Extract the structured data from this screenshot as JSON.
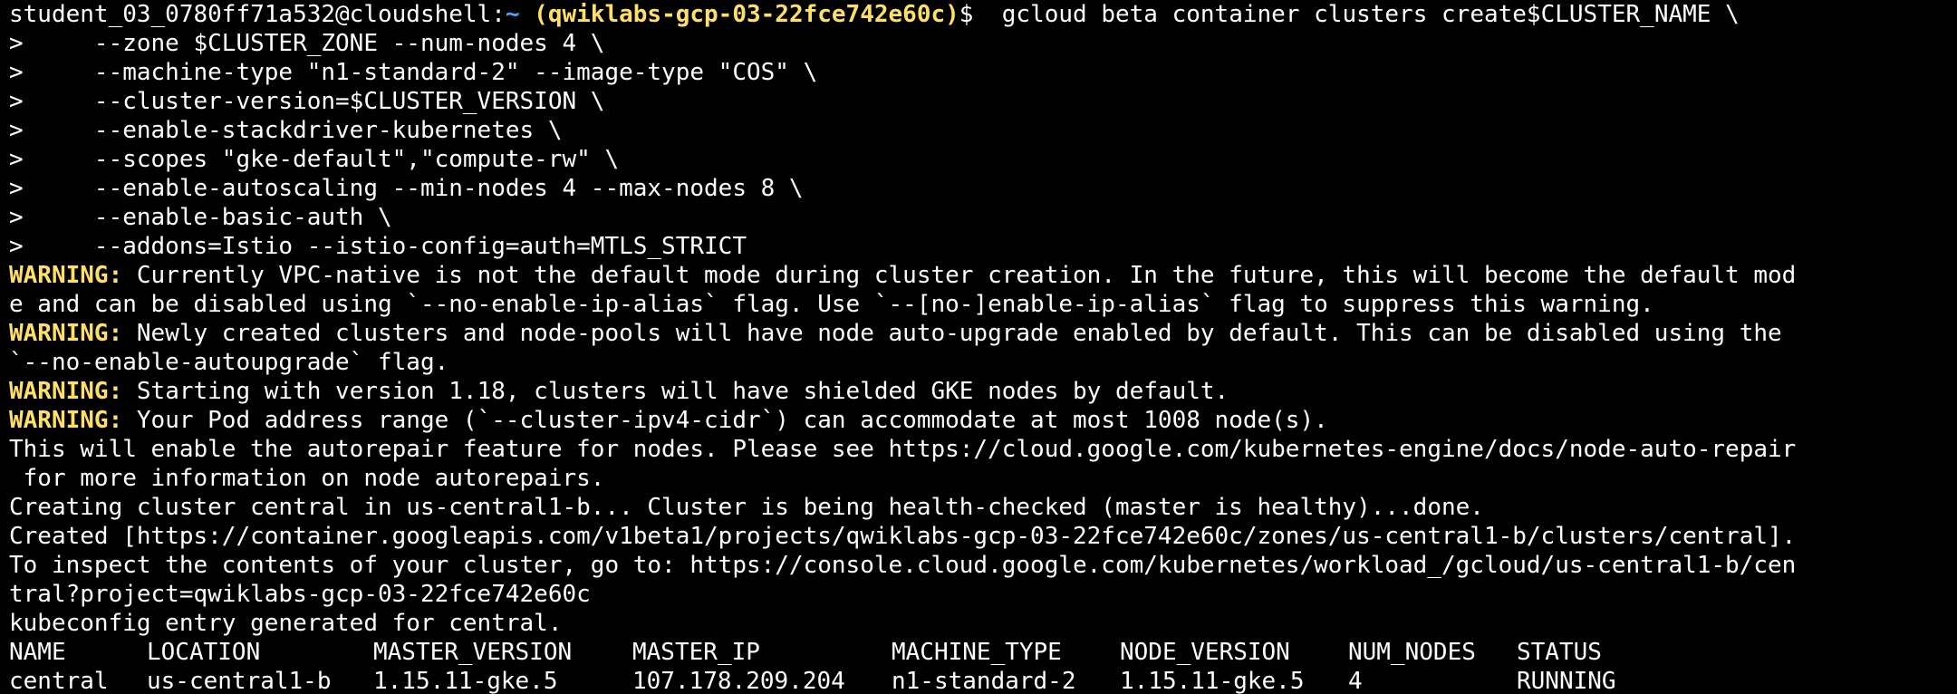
{
  "colors": {
    "background": "#000000",
    "text": "#ffffff",
    "warning_label": "#ffe066",
    "project": "#ffe066",
    "path": "#4aa3ff"
  },
  "prompt": {
    "user_host": "student_03_0780ff71a532@cloudshell:",
    "path": "~",
    "project": " (qwiklabs-gcp-03-22fce742e60c)",
    "symbol": "$",
    "command": "  gcloud beta container clusters create$CLUSTER_NAME \\"
  },
  "continuation_lines": [
    ">     --zone $CLUSTER_ZONE --num-nodes 4 \\",
    ">     --machine-type \"n1-standard-2\" --image-type \"COS\" \\",
    ">     --cluster-version=$CLUSTER_VERSION \\",
    ">     --enable-stackdriver-kubernetes \\",
    ">     --scopes \"gke-default\",\"compute-rw\" \\",
    ">     --enable-autoscaling --min-nodes 4 --max-nodes 8 \\",
    ">     --enable-basic-auth \\",
    ">     --addons=Istio --istio-config=auth=MTLS_STRICT"
  ],
  "warnings": [
    {
      "label": "WARNING:",
      "text": " Currently VPC-native is not the default mode during cluster creation. In the future, this will become the default mod",
      "wrap": "e and can be disabled using `--no-enable-ip-alias` flag. Use `--[no-]enable-ip-alias` flag to suppress this warning."
    },
    {
      "label": "WARNING:",
      "text": " Newly created clusters and node-pools will have node auto-upgrade enabled by default. This can be disabled using the",
      "wrap": "`--no-enable-autoupgrade` flag."
    },
    {
      "label": "WARNING:",
      "text": " Starting with version 1.18, clusters will have shielded GKE nodes by default."
    },
    {
      "label": "WARNING:",
      "text": " Your Pod address range (`--cluster-ipv4-cidr`) can accommodate at most 1008 node(s)."
    }
  ],
  "output_lines": [
    "This will enable the autorepair feature for nodes. Please see https://cloud.google.com/kubernetes-engine/docs/node-auto-repair",
    " for more information on node autorepairs.",
    "Creating cluster central in us-central1-b... Cluster is being health-checked (master is healthy)...done.",
    "Created [https://container.googleapis.com/v1beta1/projects/qwiklabs-gcp-03-22fce742e60c/zones/us-central1-b/clusters/central].",
    "To inspect the contents of your cluster, go to: https://console.cloud.google.com/kubernetes/workload_/gcloud/us-central1-b/cen",
    "tral?project=qwiklabs-gcp-03-22fce742e60c",
    "kubeconfig entry generated for central."
  ],
  "table": {
    "headers": [
      "NAME",
      "LOCATION",
      "MASTER_VERSION",
      "MASTER_IP",
      "MACHINE_TYPE",
      "NODE_VERSION",
      "NUM_NODES",
      "STATUS"
    ],
    "rows": [
      [
        "central",
        "us-central1-b",
        "1.15.11-gke.5",
        "107.178.209.204",
        "n1-standard-2",
        "1.15.11-gke.5",
        "4",
        "RUNNING"
      ]
    ]
  }
}
